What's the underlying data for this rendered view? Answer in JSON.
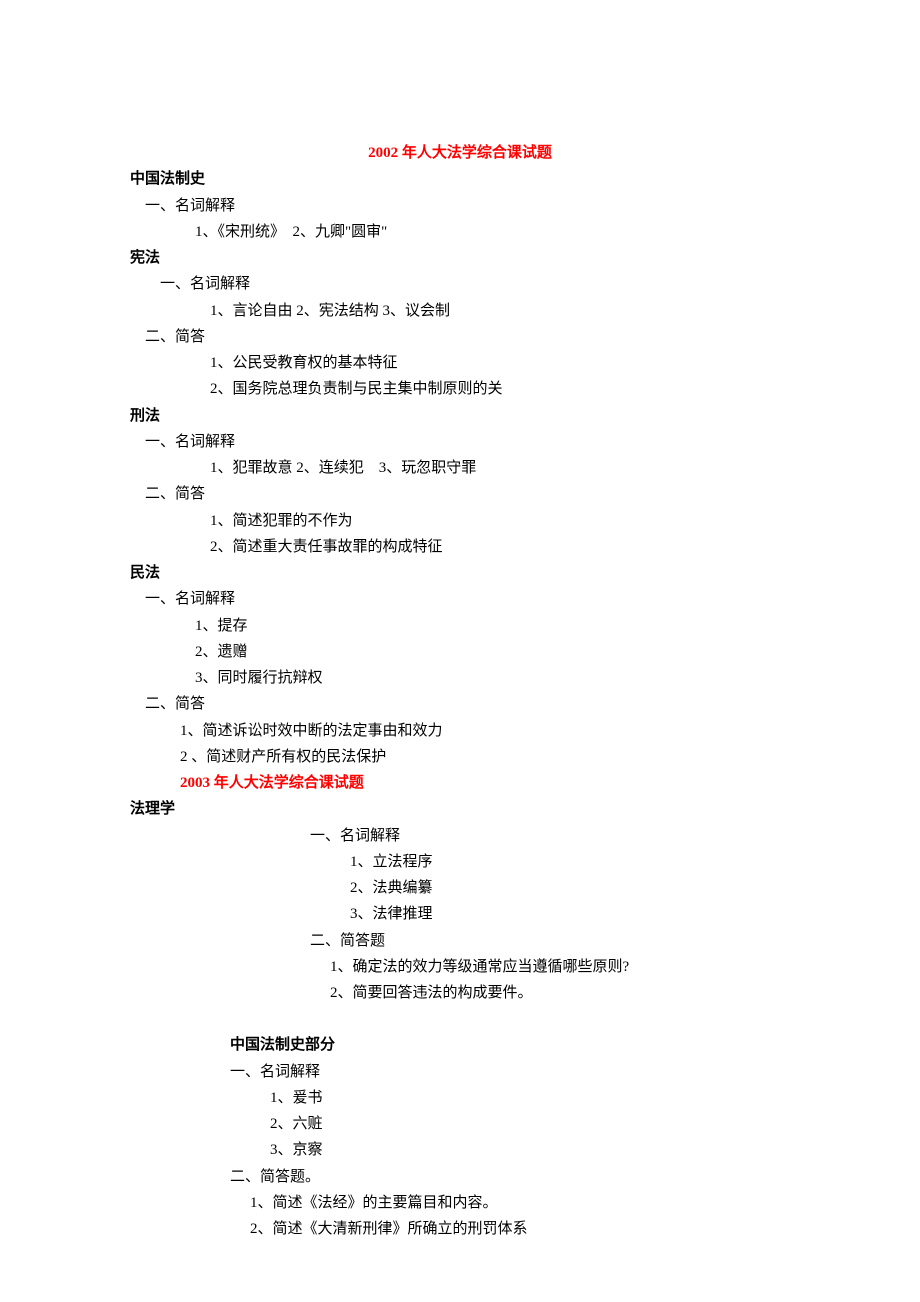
{
  "title2002": "2002 年人大法学综合课试题",
  "sec_history": "中国法制史",
  "h_nouns": "一、名词解释",
  "h_item1": "1、《宋刑统》　2、九卿\"圆审\"",
  "sec_const": "宪法",
  "c_nouns": "一、名词解释",
  "c_item1": "1、言论自由 2、宪法结构 3、议会制",
  "c_short": "二、简答",
  "c_s1": "1、公民受教育权的基本特征",
  "c_s2": "2、国务院总理负责制与民主集中制原则的关",
  "sec_crim": "刑法",
  "cr_nouns": "一、名词解释",
  "cr_item1": "1、犯罪故意 2、连续犯　3、玩忽职守罪",
  "cr_short": "二、简答",
  "cr_s1": "1、简述犯罪的不作为",
  "cr_s2": "2、简述重大责任事故罪的构成特征",
  "sec_civil": "民法",
  "cv_nouns": "一、名词解释",
  "cv_n1": "1、提存",
  "cv_n2": "2、遗赠",
  "cv_n3": "3、同时履行抗辩权",
  "cv_short": "二、简答",
  "cv_s1": "1、简述诉讼时效中断的法定事由和效力",
  "cv_s2": "2 、简述财产所有权的民法保护",
  "title2003": "2003  年人大法学综合课试题",
  "sec_juris": "法理学",
  "j_nouns": "一、名词解释",
  "j_n1": "1、立法程序",
  "j_n2": "2、法典编纂",
  "j_n3": "3、法律推理",
  "j_short": "二、简答题",
  "j_s1": "1、确定法的效力等级通常应当遵循哪些原则?",
  "j_s2": "2、简要回答违法的构成要件。",
  "sec_history2": "中国法制史部分",
  "h2_nouns": "一、名词解释",
  "h2_n1": "1、爰书",
  "h2_n2": "2、六赃",
  "h2_n3": "3、京察",
  "h2_short": "二、简答题。",
  "h2_s1": "1、简述《法经》的主要篇目和内容。",
  "h2_s2": "2、简述《大清新刑律》所确立的刑罚体系"
}
